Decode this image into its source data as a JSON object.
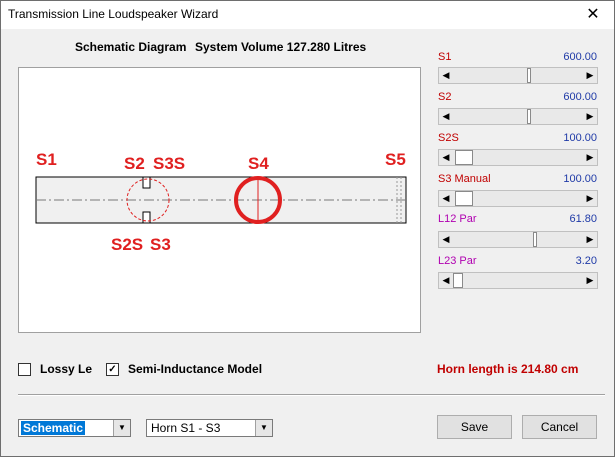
{
  "window": {
    "title": "Transmission Line Loudspeaker Wizard",
    "close_glyph": "✕"
  },
  "header": {
    "diagram_label": "Schematic Diagram",
    "system_volume": "System Volume 127.280 Litres"
  },
  "diagram": {
    "labels": {
      "s1": "S1",
      "s2": "S2",
      "s3s": "S3S",
      "s4": "S4",
      "s5": "S5",
      "s2s": "S2S",
      "s3": "S3"
    },
    "colors": {
      "label": "#e02020",
      "pipe": "#000000",
      "driver": "#e02020"
    }
  },
  "sliders": [
    {
      "label": "S1",
      "value": "600.00",
      "label_color": "#c00000"
    },
    {
      "label": "S2",
      "value": "600.00",
      "label_color": "#c00000"
    },
    {
      "label": "S2S",
      "value": "100.00",
      "label_color": "#c00000"
    },
    {
      "label": "S3  Manual",
      "value": "100.00",
      "label_color": "#c00000"
    },
    {
      "label": "L12  Par",
      "value": "61.80",
      "label_color": "#b000b0"
    },
    {
      "label": "L23  Par",
      "value": "3.20",
      "label_color": "#b000b0"
    }
  ],
  "checkboxes": {
    "lossy": {
      "label": "Lossy Le",
      "checked_glyph": ""
    },
    "semi": {
      "label": "Semi-Inductance Model",
      "checked_glyph": "✓"
    }
  },
  "horn_length": "Horn length is 214.80 cm",
  "combos": {
    "view": {
      "value": "Schematic",
      "arrow": "▼"
    },
    "horn": {
      "value": "Horn S1 - S3",
      "arrow": "▼"
    }
  },
  "buttons": {
    "save": "Save",
    "cancel": "Cancel"
  },
  "slider_arrows": {
    "left": "◀",
    "right": "▶"
  }
}
